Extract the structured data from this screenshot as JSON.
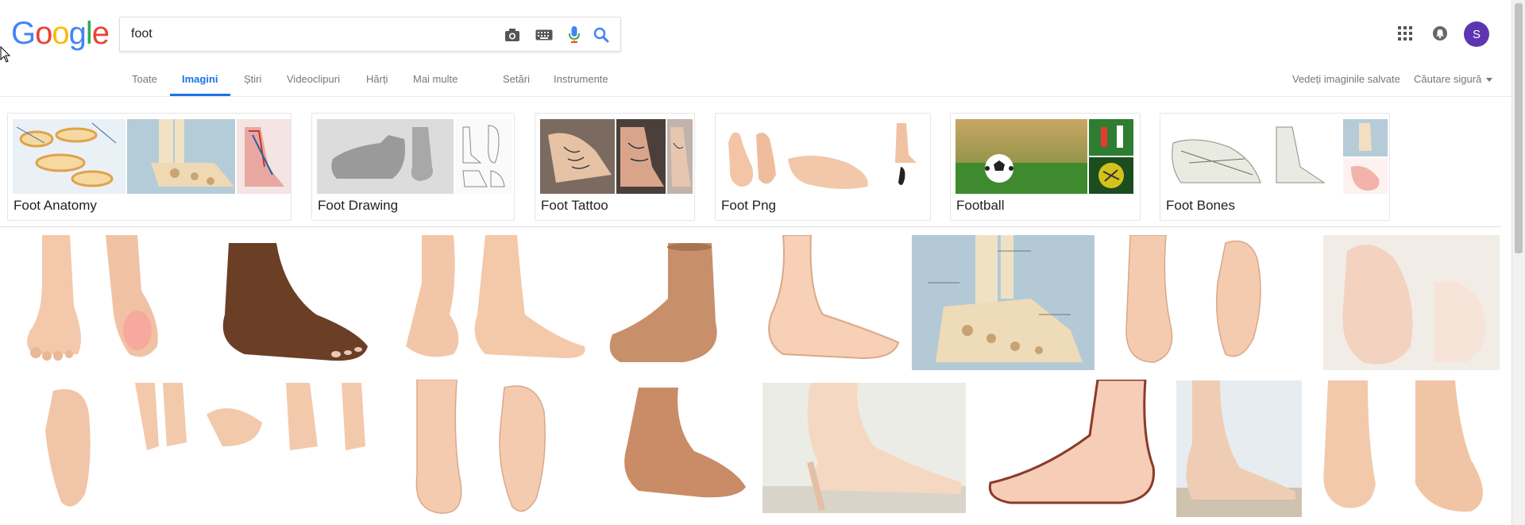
{
  "logo": {
    "text": "Google",
    "letters": [
      "G",
      "o",
      "o",
      "g",
      "l",
      "e"
    ],
    "colors": [
      "#4285F4",
      "#EA4335",
      "#FBBC05",
      "#4285F4",
      "#34A853",
      "#EA4335"
    ]
  },
  "search": {
    "query": "foot"
  },
  "icons": {
    "camera": "camera-icon",
    "keyboard": "keyboard-icon",
    "mic": "microphone-icon",
    "search": "search-icon",
    "apps": "apps-grid-icon",
    "notifications": "notifications-icon"
  },
  "account": {
    "initial": "S",
    "color": "#5e35b1"
  },
  "tabs": [
    {
      "label": "Toate"
    },
    {
      "label": "Imagini",
      "active": true
    },
    {
      "label": "Știri"
    },
    {
      "label": "Videoclipuri"
    },
    {
      "label": "Hărți"
    },
    {
      "label": "Mai multe"
    },
    {
      "label": "Setări"
    },
    {
      "label": "Instrumente"
    }
  ],
  "right_links": {
    "saved": "Vedeți imaginile salvate",
    "safe": "Căutare sigură"
  },
  "suggestions": [
    {
      "label": "Foot Anatomy"
    },
    {
      "label": "Foot Drawing"
    },
    {
      "label": "Foot Tattoo"
    },
    {
      "label": "Foot Png"
    },
    {
      "label": "Football"
    },
    {
      "label": "Foot Bones"
    }
  ],
  "colors": {
    "accent": "#1a73e8",
    "skin": "#f2c6a8",
    "skin_dark": "#6b3e26"
  }
}
